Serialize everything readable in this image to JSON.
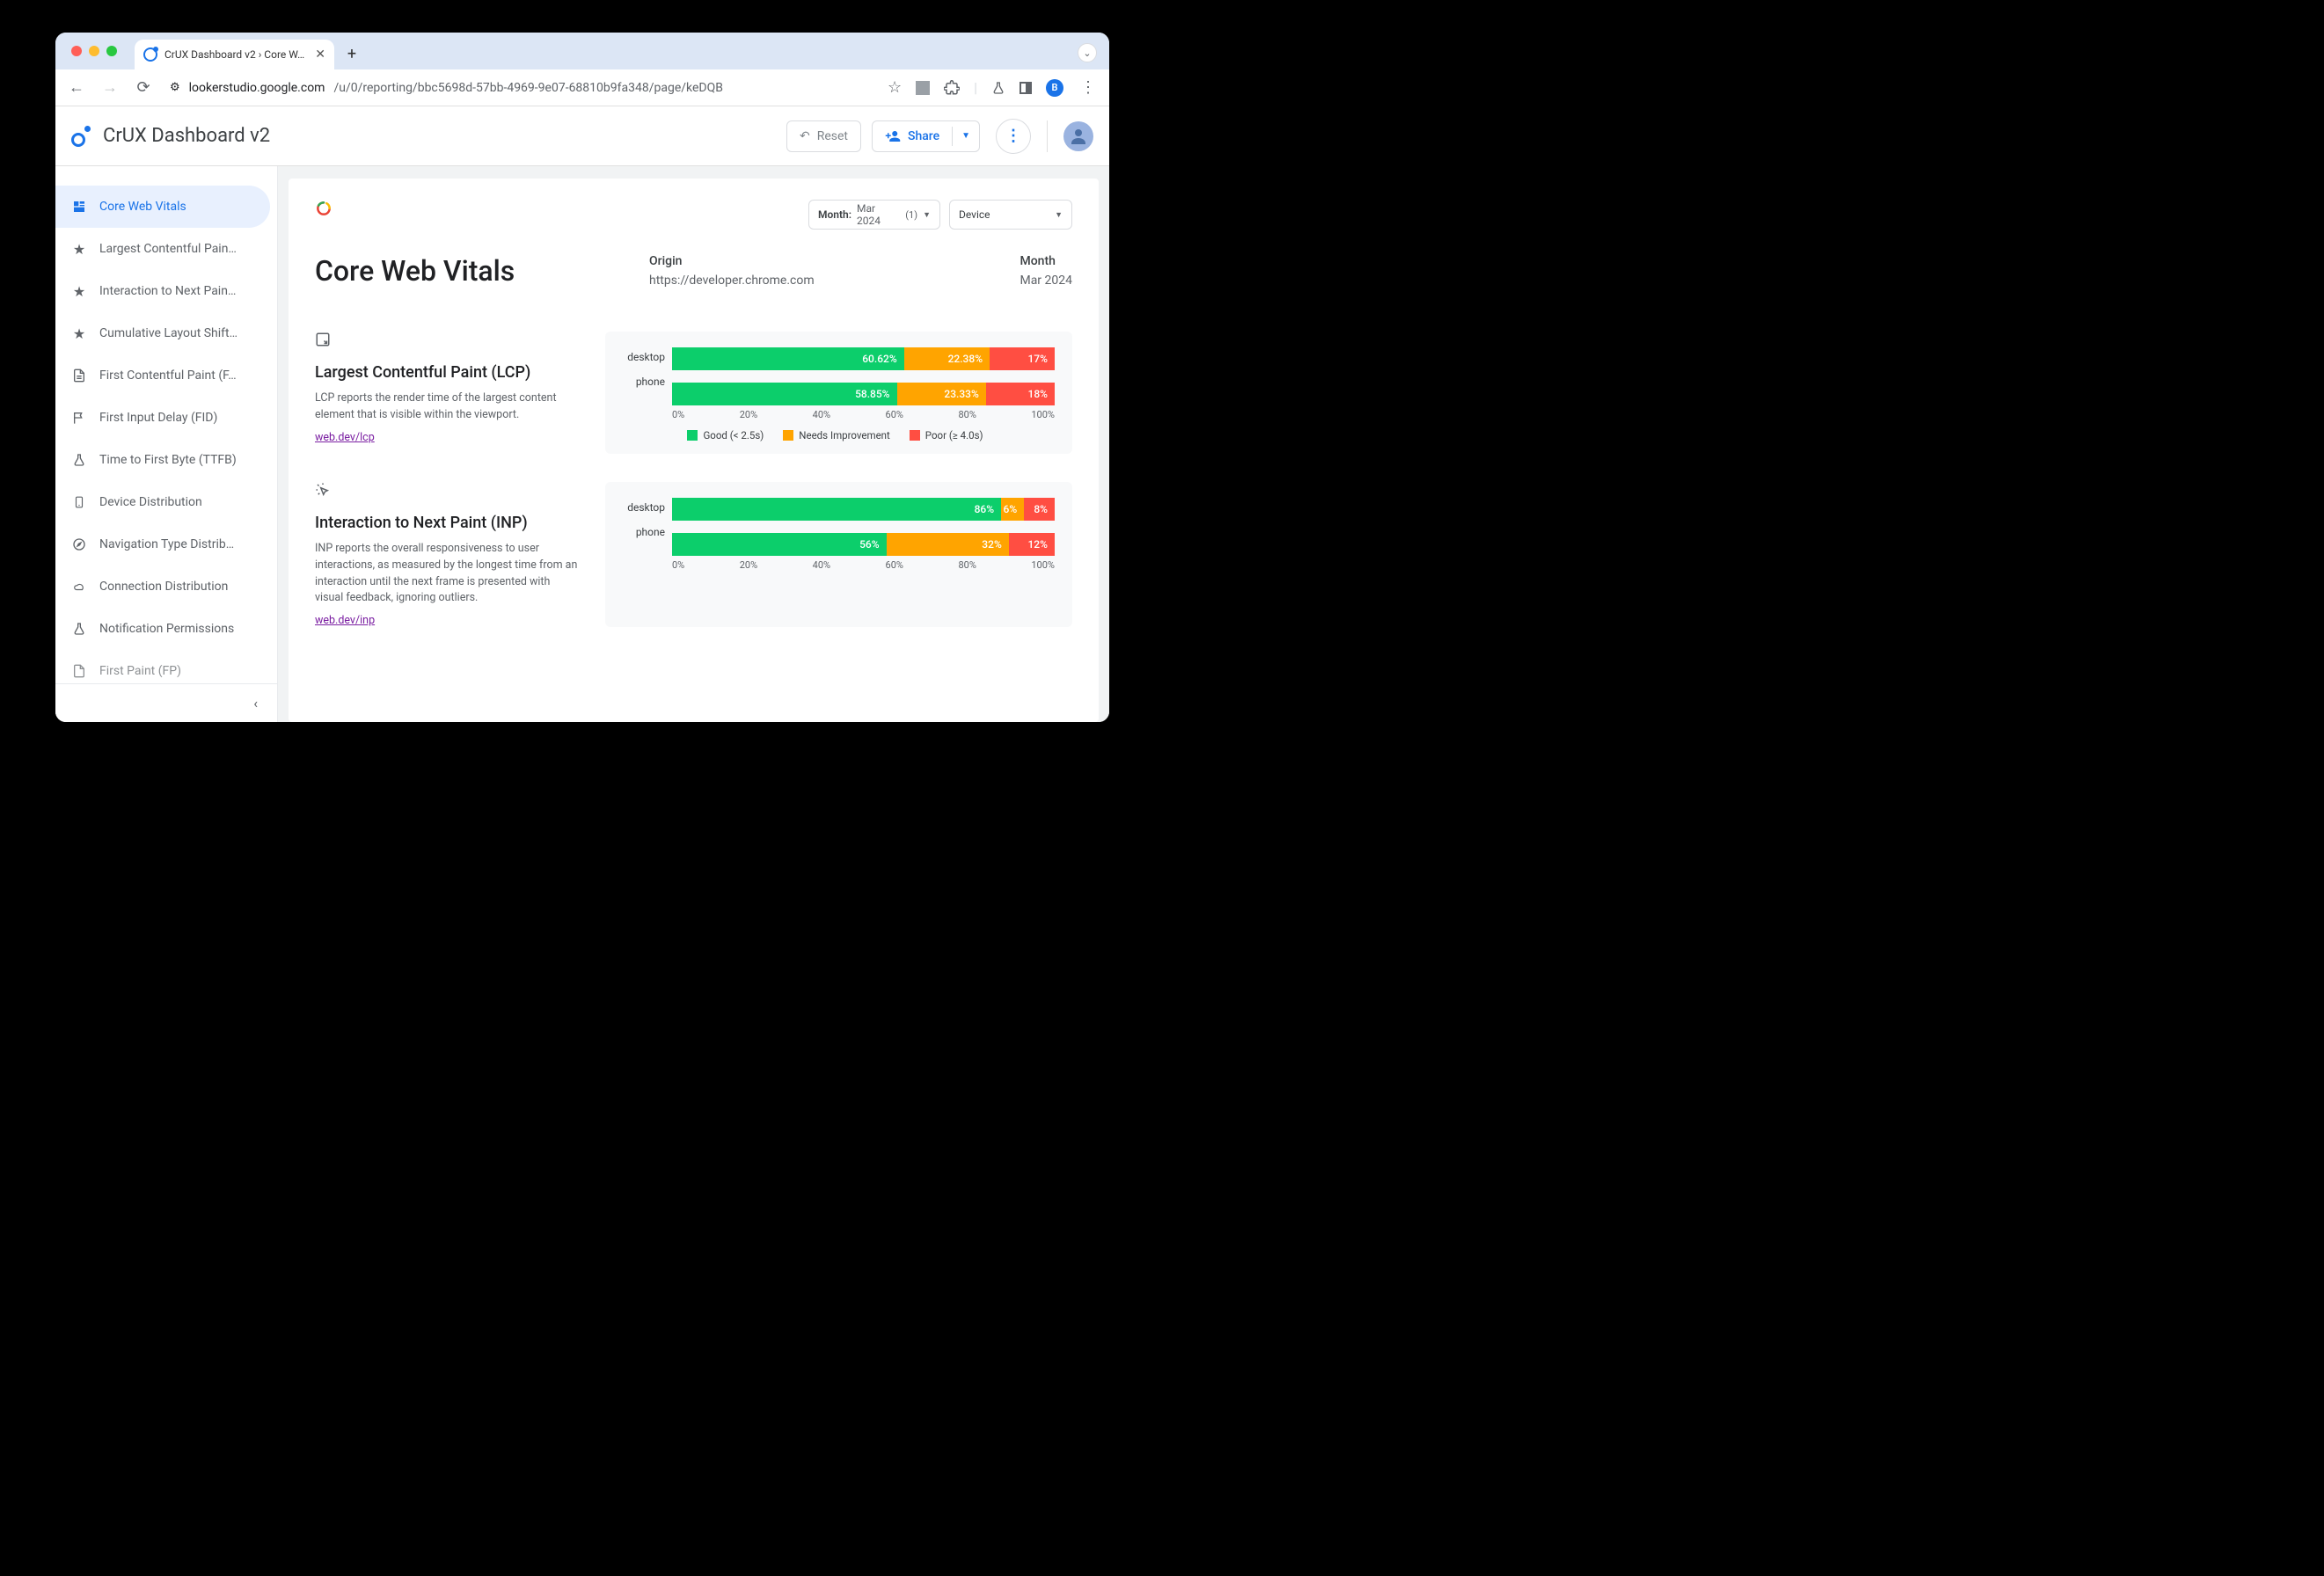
{
  "browser": {
    "tab_title": "CrUX Dashboard v2 › Core W…",
    "url_host": "lookerstudio.google.com",
    "url_path": "/u/0/reporting/bbc5698d-57bb-4969-9e07-68810b9fa348/page/keDQB",
    "profile_letter": "B"
  },
  "header": {
    "title": "CrUX Dashboard v2",
    "reset": "Reset",
    "share": "Share"
  },
  "sidebar": {
    "items": [
      {
        "label": "Core Web Vitals",
        "active": true
      },
      {
        "label": "Largest Contentful Pain…"
      },
      {
        "label": "Interaction to Next Pain…"
      },
      {
        "label": "Cumulative Layout Shift…"
      },
      {
        "label": "First Contentful Paint (F…"
      },
      {
        "label": "First Input Delay (FID)"
      },
      {
        "label": "Time to First Byte (TTFB)"
      },
      {
        "label": "Device Distribution"
      },
      {
        "label": "Navigation Type Distrib…"
      },
      {
        "label": "Connection Distribution"
      },
      {
        "label": "Notification Permissions"
      },
      {
        "label": "First Paint (FP)"
      }
    ]
  },
  "filters": {
    "month_label": "Month:",
    "month_value": "Mar 2024",
    "month_count": "(1)",
    "device_label": "Device"
  },
  "page": {
    "title": "Core Web Vitals",
    "origin_k": "Origin",
    "origin_v": "https://developer.chrome.com",
    "month_k": "Month",
    "month_v": "Mar 2024"
  },
  "lcp": {
    "title": "Largest Contentful Paint (LCP)",
    "desc": "LCP reports the render time of the largest content element that is visible within the viewport.",
    "link": "web.dev/lcp"
  },
  "inp": {
    "title": "Interaction to Next Paint (INP)",
    "desc": "INP reports the overall responsiveness to user interactions, as measured by the longest time from an interaction until the next frame is presented with visual feedback, ignoring outliers.",
    "link": "web.dev/inp"
  },
  "axis": {
    "t0": "0%",
    "t20": "20%",
    "t40": "40%",
    "t60": "60%",
    "t80": "80%",
    "t100": "100%"
  },
  "legend": {
    "lcp_good": "Good (< 2.5s)",
    "lcp_ni": "Needs Improvement",
    "lcp_poor": "Poor (≥ 4.0s)"
  },
  "chart_data": [
    {
      "id": "lcp",
      "type": "bar",
      "title": "Largest Contentful Paint (LCP)",
      "categories": [
        "desktop",
        "phone"
      ],
      "series": [
        {
          "name": "Good (< 2.5s)",
          "color": "#0cce6b",
          "values": [
            60.62,
            58.85
          ]
        },
        {
          "name": "Needs Improvement",
          "color": "#ffa400",
          "values": [
            22.38,
            23.33
          ]
        },
        {
          "name": "Poor (≥ 4.0s)",
          "color": "#ff4e42",
          "values": [
            17,
            18
          ]
        }
      ],
      "xlabel": "",
      "ylabel": "",
      "ylim": [
        0,
        100
      ],
      "unit": "%"
    },
    {
      "id": "inp",
      "type": "bar",
      "title": "Interaction to Next Paint (INP)",
      "categories": [
        "desktop",
        "phone"
      ],
      "series": [
        {
          "name": "Good",
          "color": "#0cce6b",
          "values": [
            86,
            56
          ]
        },
        {
          "name": "Needs Improvement",
          "color": "#ffa400",
          "values": [
            6,
            32
          ]
        },
        {
          "name": "Poor",
          "color": "#ff4e42",
          "values": [
            8,
            12
          ]
        }
      ],
      "xlabel": "",
      "ylabel": "",
      "ylim": [
        0,
        100
      ],
      "unit": "%"
    }
  ]
}
